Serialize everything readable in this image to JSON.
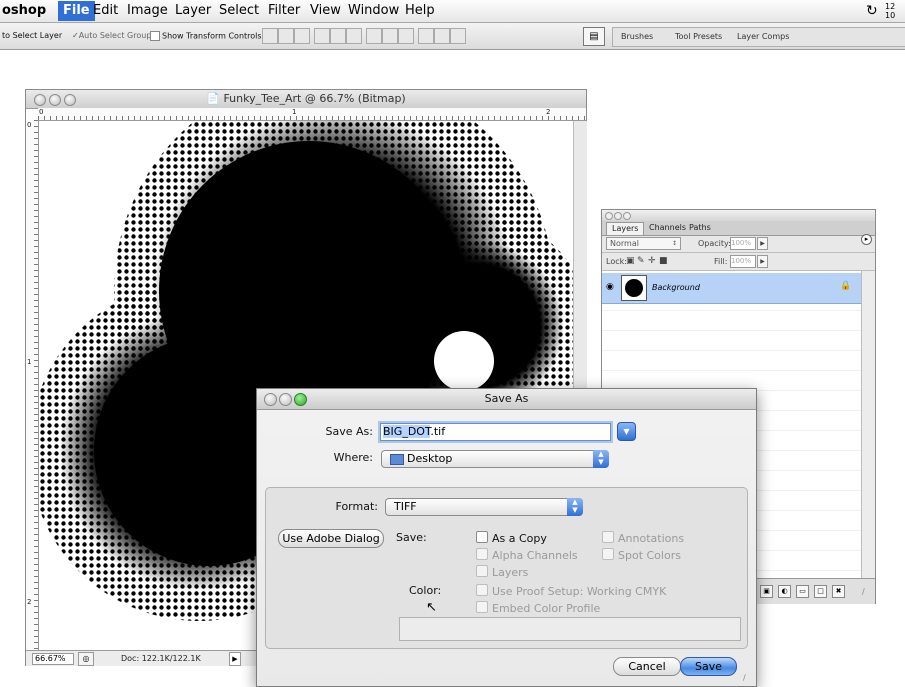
{
  "menubar": {
    "app_name": "oshop",
    "items": [
      "File",
      "Edit",
      "Image",
      "Layer",
      "Select",
      "Filter",
      "View",
      "Window",
      "Help"
    ],
    "clock_line1": "12",
    "clock_line2": "10"
  },
  "options_bar": {
    "auto_select_layer": "to Select Layer",
    "auto_select_groups": "Auto Select Groups",
    "show_transform_controls": "Show Transform Controls",
    "tabs": [
      "Brushes",
      "Tool Presets",
      "Layer Comps"
    ]
  },
  "document": {
    "title": "Funky_Tee_Art @ 66.7% (Bitmap)",
    "ruler_h": [
      "0",
      "1",
      "2"
    ],
    "ruler_v": [
      "0",
      "1",
      "2"
    ],
    "zoom": "66.67%",
    "doc_info": "Doc: 122.1K/122.1K"
  },
  "layers_palette": {
    "tabs": [
      "Layers",
      "Channels",
      "Paths"
    ],
    "blend_mode": "Normal",
    "opacity_label": "Opacity:",
    "opacity_value": "100%",
    "lock_label": "Lock:",
    "fill_label": "Fill:",
    "fill_value": "100%",
    "layer_name": "Background"
  },
  "save_dialog": {
    "title": "Save As",
    "save_as_label": "Save As:",
    "filename_selected": "BIG_DOT",
    "filename_ext": ".tif",
    "where_label": "Where:",
    "where_value": "Desktop",
    "format_label": "Format:",
    "format_value": "TIFF",
    "adobe_dialog_button": "Use Adobe Dialog",
    "save_label": "Save:",
    "as_a_copy": "As a Copy",
    "alpha_channels": "Alpha Channels",
    "layers": "Layers",
    "annotations": "Annotations",
    "spot_colors": "Spot Colors",
    "color_label": "Color:",
    "use_proof_setup": "Use Proof Setup:  Working CMYK",
    "embed_color_profile": "Embed Color Profile",
    "cancel_button": "Cancel",
    "save_button": "Save"
  }
}
